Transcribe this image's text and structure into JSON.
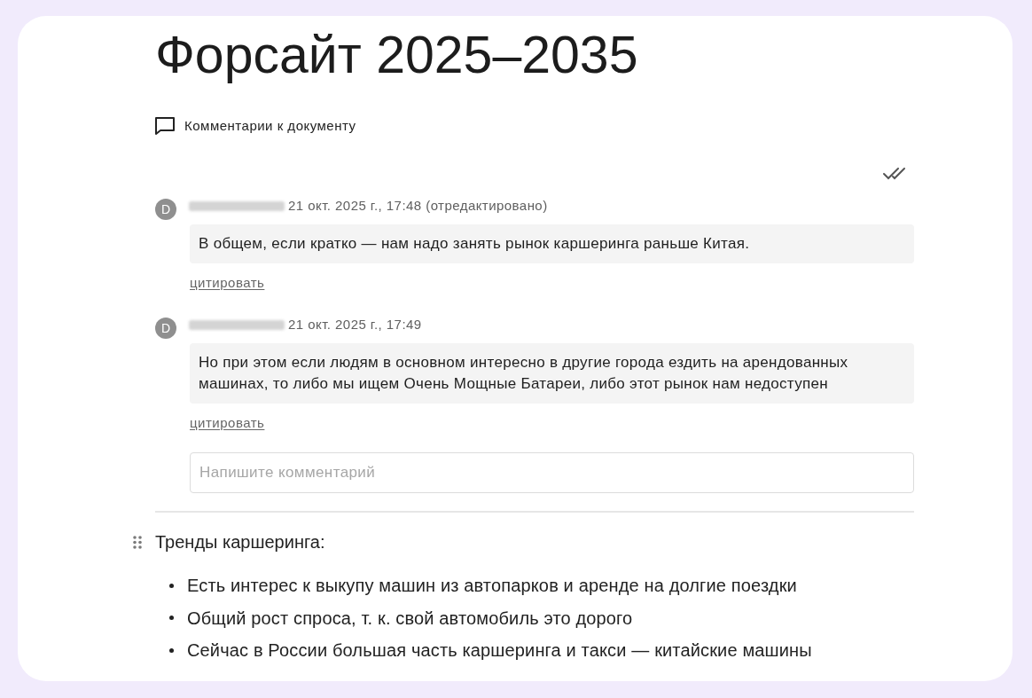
{
  "document": {
    "title": "Форсайт 2025–2035"
  },
  "comments_panel": {
    "header": "Комментарии к документу",
    "comments": [
      {
        "avatar_initial": "D",
        "meta": "21 окт. 2025 г., 17:48 (отредактировано)",
        "text": "В общем, если кратко — нам надо занять рынок каршеринга раньше Китая.",
        "quote_link": "цитировать"
      },
      {
        "avatar_initial": "D",
        "meta": "21 окт. 2025 г., 17:49",
        "text": "Но при этом если людям в основном интересно в другие города ездить на арендованных машинах, то либо мы ищем Очень Мощные Батареи, либо этот рынок нам недоступен",
        "quote_link": "цитировать"
      }
    ],
    "input": {
      "placeholder": "Напишите комментарий"
    }
  },
  "content": {
    "heading": "Тренды каршеринга:",
    "bullets": [
      "Есть интерес к выкупу машин из автопарков и аренде на долгие поездки",
      "Общий рост спроса, т. к. свой автомобиль это дорого",
      "Сейчас в России большая часть каршеринга и такси — китайские машины"
    ]
  }
}
